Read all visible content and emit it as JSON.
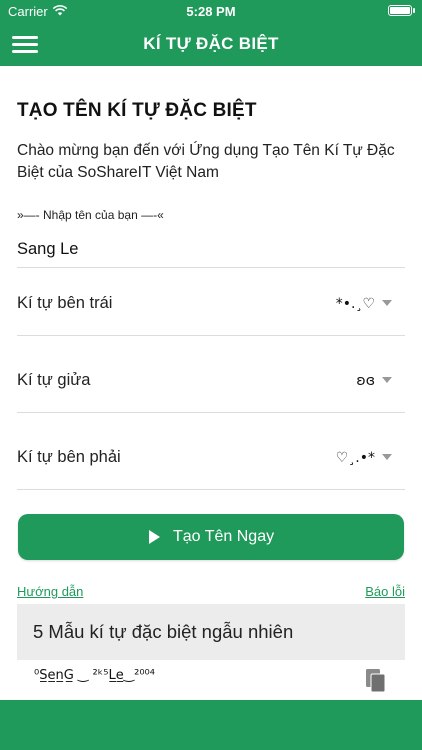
{
  "status_bar": {
    "carrier": "Carrier",
    "time": "5:28 PM"
  },
  "app_bar": {
    "title": "KÍ TỰ ĐẶC BIỆT"
  },
  "main": {
    "page_title": "TẠO TÊN KÍ TỰ ĐẶC BIỆT",
    "welcome_text": "Chào mừng bạn đến với Ứng dụng Tạo Tên Kí Tự Đặc Biệt của SoShareIT Việt Nam",
    "name_label": "»—- Nhập tên của bạn —-«",
    "name_value": "Sang Le"
  },
  "selectors": {
    "left": {
      "label": "Kí tự bên trái",
      "value": "*•.¸♡"
    },
    "middle": {
      "label": "Kí tự giửa",
      "value": "ʚɞ"
    },
    "right": {
      "label": "Kí tự bên phải",
      "value": "♡¸.•*"
    }
  },
  "create_button": {
    "label": "Tạo Tên Ngay"
  },
  "links": {
    "guide": "Hướng dẫn",
    "report": "Báo lỗi"
  },
  "random": {
    "header": "5 Mẫu kí tự đặc biệt ngẫu nhiên",
    "first_result": "⁰S̲e̲n̲G̲ ‿ ²ᵏ⁵L̲e̲‿²⁰⁰⁴"
  },
  "colors": {
    "primary": "#1f9a5b",
    "panel": "#ececec"
  },
  "icons": [
    "menu-icon",
    "wifi-icon",
    "battery-icon",
    "dropdown-caret-icon",
    "play-icon",
    "copy-icon"
  ]
}
